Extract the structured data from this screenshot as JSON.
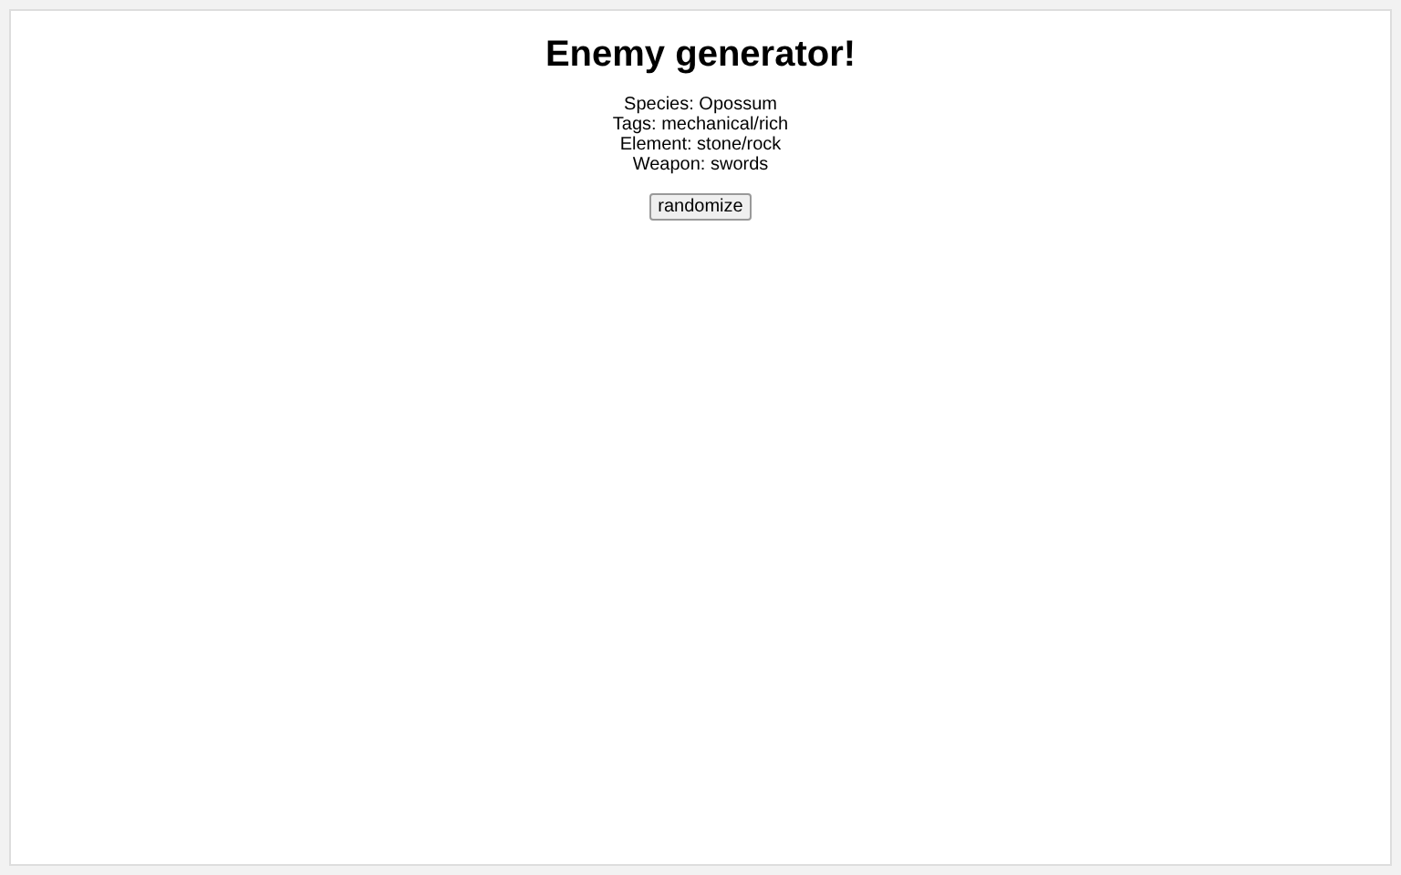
{
  "title": "Enemy generator!",
  "lines": [
    "Species: Opossum",
    "Tags: mechanical/rich",
    "Element: stone/rock",
    "Weapon: swords"
  ],
  "button": "randomize"
}
